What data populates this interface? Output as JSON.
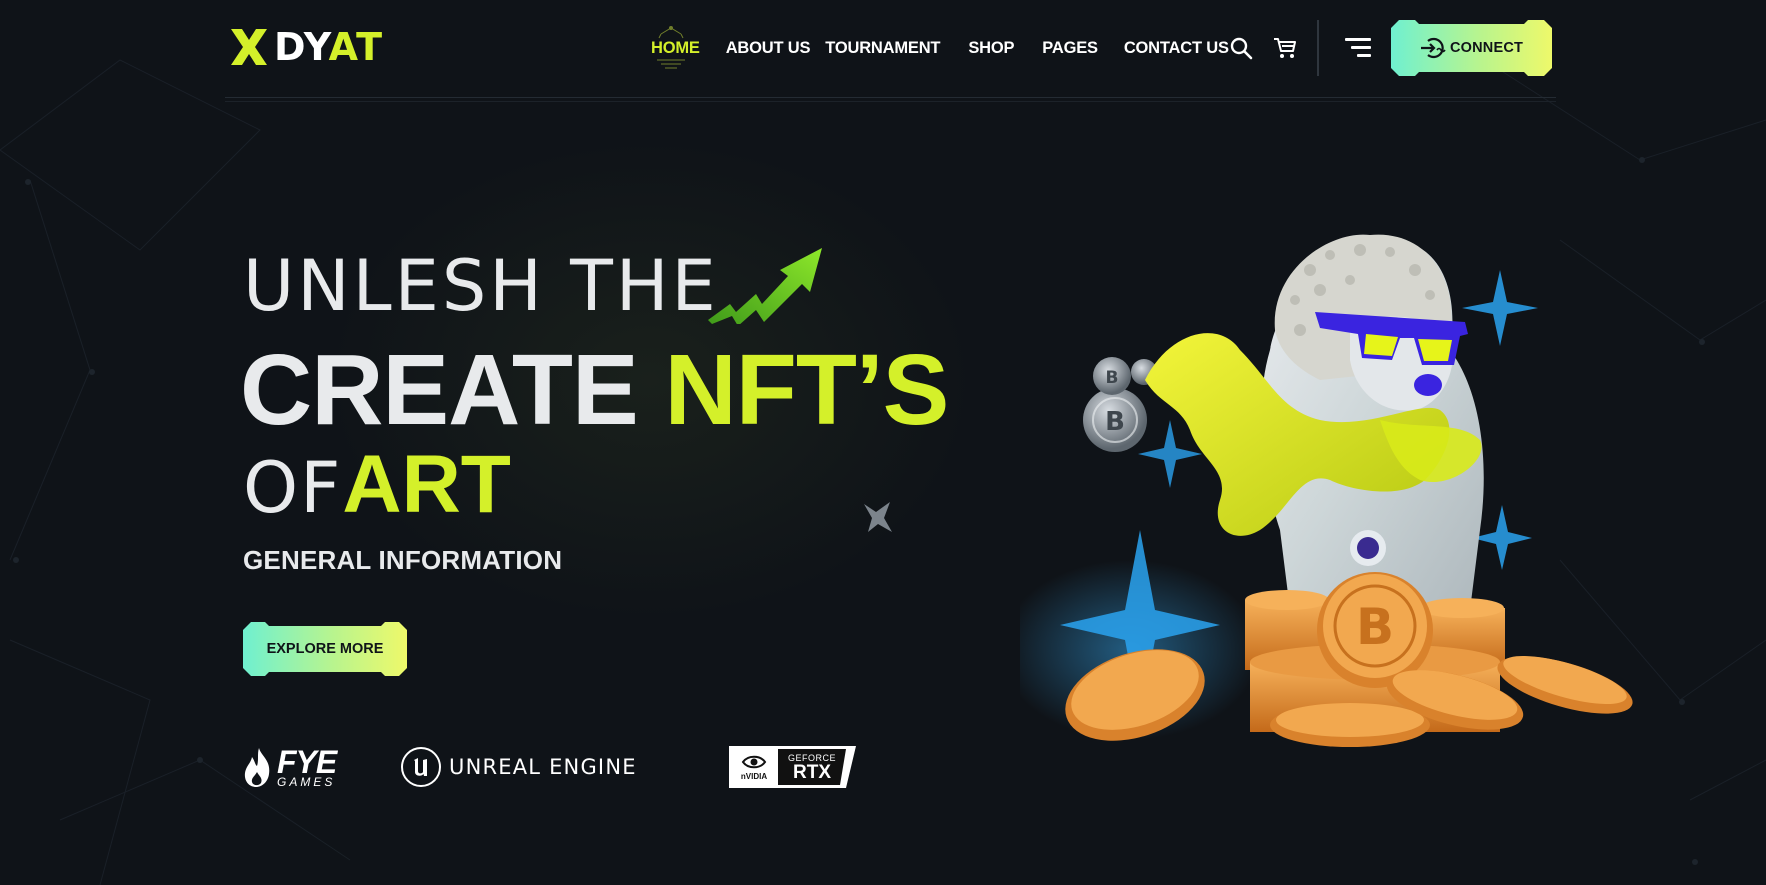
{
  "colors": {
    "background": "#0f1318",
    "accent": "#d4f02a",
    "button_gradient": [
      "#6ff0d0",
      "#b8f48e",
      "#eef96a"
    ],
    "text": "#e8eaec"
  },
  "header": {
    "logo": {
      "part1": "DY",
      "part2": "AT",
      "icon": "x-logo-icon"
    },
    "nav": [
      "HOME",
      "ABOUT US",
      "TOURNAMENT",
      "SHOP",
      "PAGES",
      "CONTACT US"
    ],
    "active_nav": "HOME",
    "icons": [
      "search-icon",
      "cart-icon",
      "menu-icon"
    ],
    "connect_label": "CONNECT"
  },
  "hero": {
    "line1": "UNLESH THE",
    "line2_white": "CREATE",
    "line2_accent": "NFT’S",
    "line3_white": "OF",
    "line3_accent": "ART",
    "subtitle": "GENERAL INFORMATION",
    "cta_label": "EXPLORE MORE"
  },
  "partners": {
    "fye": {
      "main": "FYE",
      "sub": "GAMES"
    },
    "unreal": {
      "text": "UNREAL ENGINE"
    },
    "rtx": {
      "brand": "nVIDIA",
      "line1": "GEFORCE",
      "line2": "RTX"
    }
  }
}
